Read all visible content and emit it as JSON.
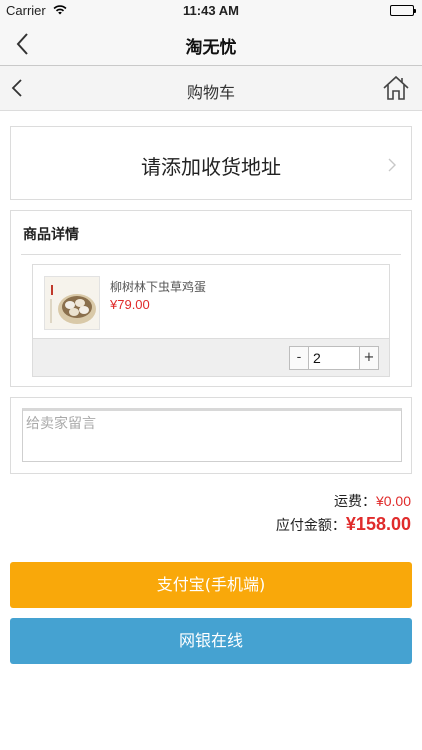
{
  "status_bar": {
    "carrier": "Carrier",
    "time": "11:43 AM"
  },
  "app_nav": {
    "title": "淘无忧",
    "back_icon": "chevron-left-icon"
  },
  "page_header": {
    "title": "购物车",
    "back_icon": "chevron-left-icon",
    "home_icon": "home-icon"
  },
  "address": {
    "label": "请添加收货地址",
    "chevron_icon": "chevron-right-icon"
  },
  "detail": {
    "heading": "商品详情",
    "product": {
      "name": "柳树林下虫草鸡蛋",
      "price": "¥79.00",
      "quantity": "2",
      "minus_label": "-",
      "plus_label": "+"
    }
  },
  "message": {
    "placeholder": "给卖家留言"
  },
  "totals": {
    "shipping_label": "运费：",
    "shipping_amount": "¥0.00",
    "total_label": "应付金额：",
    "total_amount": "¥158.00"
  },
  "payment": {
    "alipay_label": "支付宝(手机端)",
    "bank_label": "网银在线"
  },
  "colors": {
    "price_red": "#e02b2b",
    "alipay_orange": "#f9a80a",
    "bank_blue": "#45a2d1"
  }
}
